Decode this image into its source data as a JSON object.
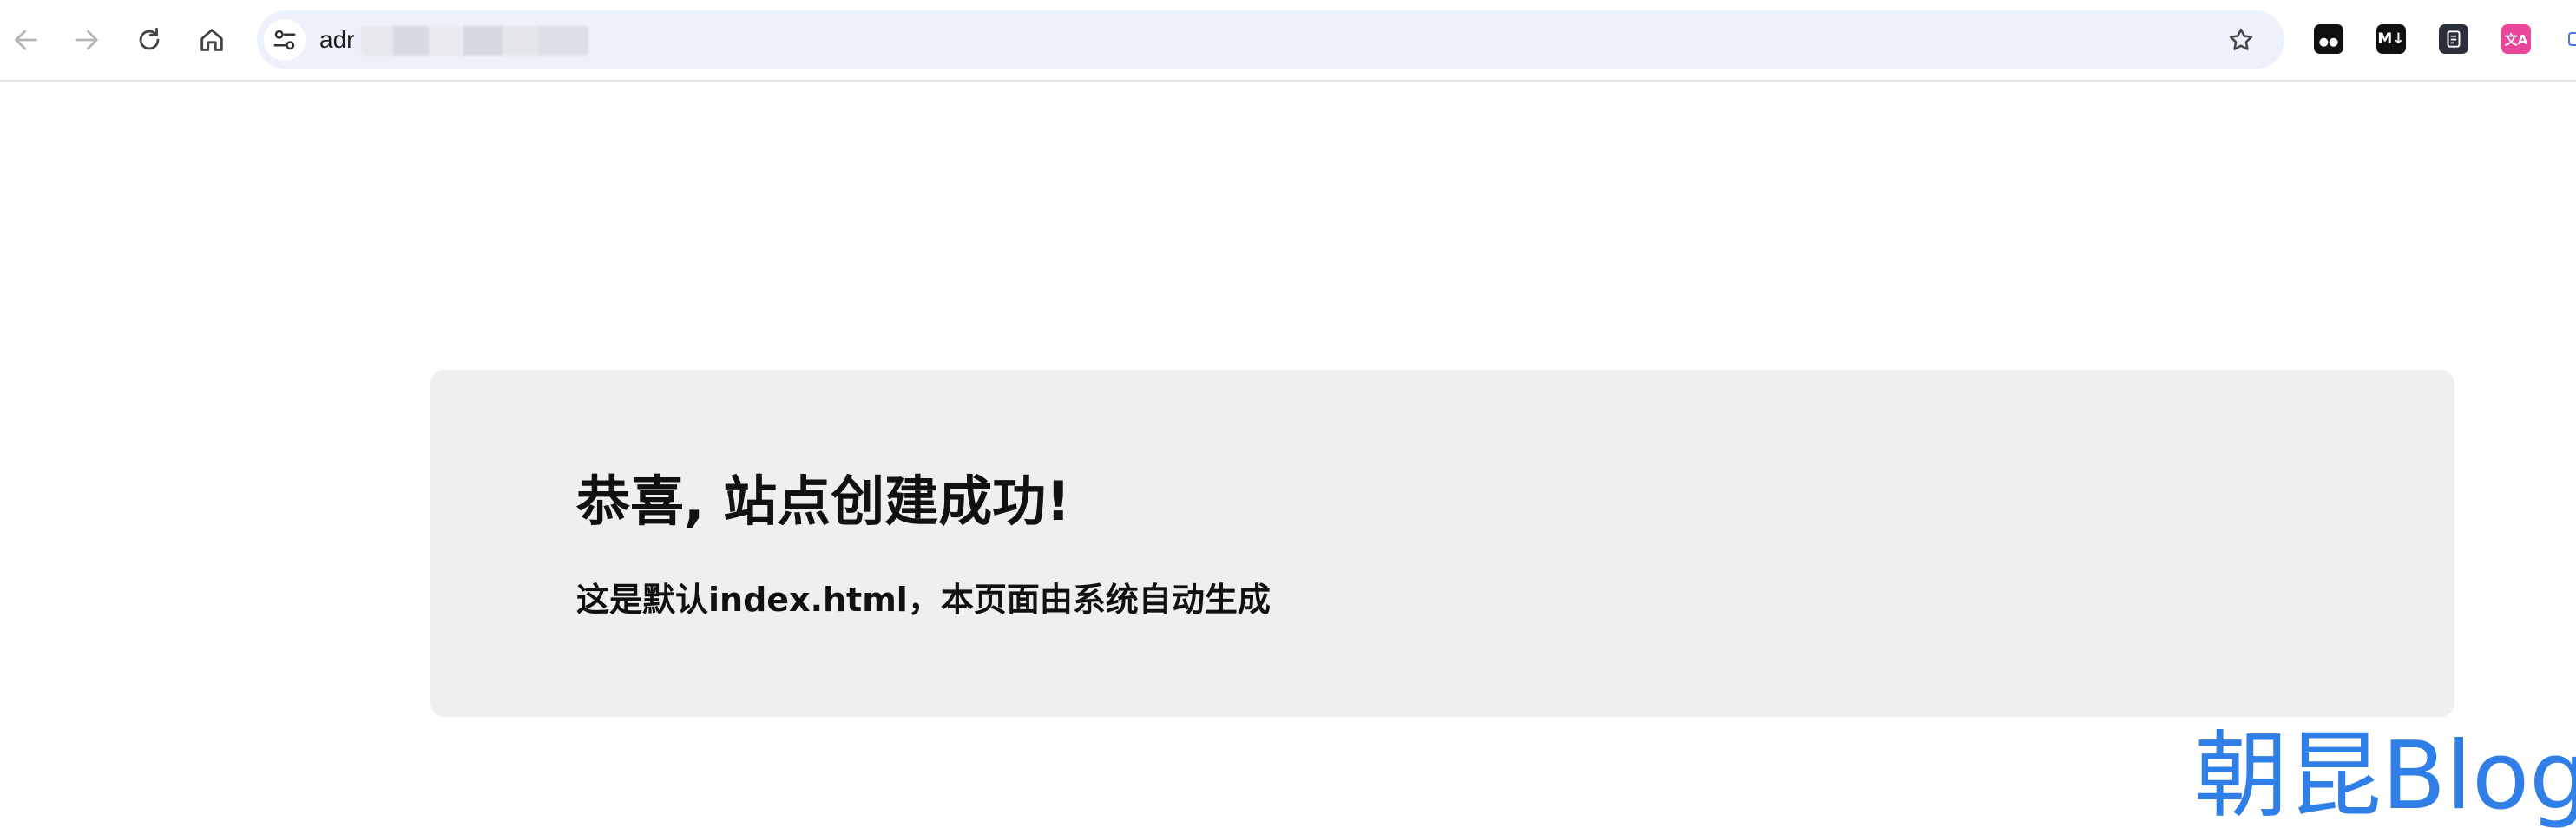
{
  "browser": {
    "url_prefix": "adr",
    "icons": {
      "back": "arrow-left-icon",
      "forward": "arrow-right-icon",
      "reload": "reload-icon",
      "home": "home-icon",
      "site_info": "tune-icon",
      "bookmark": "star-icon"
    },
    "extensions": [
      {
        "name": "tampermonkey-extension-icon"
      },
      {
        "name": "markdown-extension-icon",
        "label": "M↓"
      },
      {
        "name": "notes-extension-icon"
      },
      {
        "name": "translate-extension-icon",
        "label": "文A"
      }
    ]
  },
  "page": {
    "title": "恭喜, 站点创建成功!",
    "subtitle": "这是默认index.html，本页面由系统自动生成"
  },
  "watermark": {
    "text": "朝昆Blog"
  },
  "colors": {
    "omnibox_bg": "#ecf1fb",
    "card_bg": "#efefef",
    "watermark": "#2f7fe6",
    "translate_ext": "#e8479b"
  }
}
